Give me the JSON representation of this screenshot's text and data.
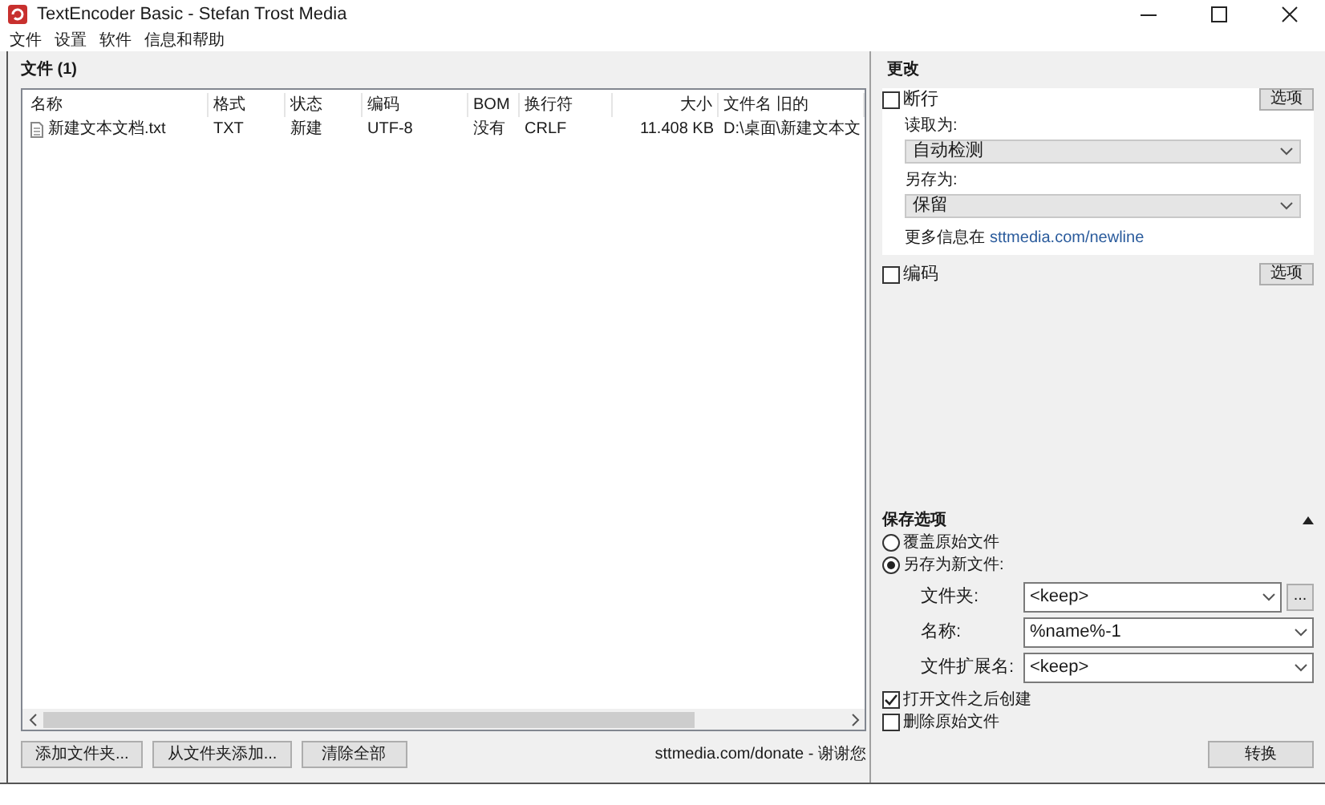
{
  "window": {
    "title": "TextEncoder Basic - Stefan Trost Media"
  },
  "menu": [
    "文件",
    "设置",
    "软件",
    "信息和帮助"
  ],
  "files": {
    "title": "文件 (1)",
    "columns": [
      "名称",
      "格式",
      "状态",
      "编码",
      "BOM",
      "换行符",
      "大小",
      "文件名 旧的"
    ],
    "rows": [
      {
        "cells": [
          "新建文本文档.txt",
          "TXT",
          "新建",
          "UTF-8",
          "没有",
          "CRLF",
          "11.408 KB",
          "D:\\桌面\\新建文本文"
        ]
      }
    ]
  },
  "buttons": [
    "添加文件夹...",
    "从文件夹添加...",
    "清除全部"
  ],
  "donate": "sttmedia.com/donate - 谢谢您",
  "changes": {
    "title": "更改",
    "newline": {
      "label": "断行",
      "checked": false,
      "options_button": "选项",
      "read_label": "读取为:",
      "read_value": "自动检测",
      "save_label": "另存为:",
      "save_value": "保留",
      "info": "更多信息在",
      "link": "sttmedia.com/newline"
    },
    "encoding": {
      "label": "编码",
      "checked": false,
      "options_button": "选项"
    }
  },
  "save_options": {
    "title": "保存选项",
    "expanded": true,
    "modes": [
      {
        "label": "覆盖原始文件",
        "selected": false
      },
      {
        "label": "另存为新文件:",
        "selected": true
      }
    ],
    "fields": [
      {
        "label": "文件夹:",
        "value": "<keep>",
        "browse": "..."
      },
      {
        "label": "名称:",
        "value": "%name%-1"
      },
      {
        "label": "文件扩展名:",
        "value": "<keep>"
      }
    ],
    "checks": [
      {
        "label": "打开文件之后创建",
        "checked": true
      },
      {
        "label": "删除原始文件",
        "checked": false
      }
    ],
    "convert_button": "转换"
  }
}
